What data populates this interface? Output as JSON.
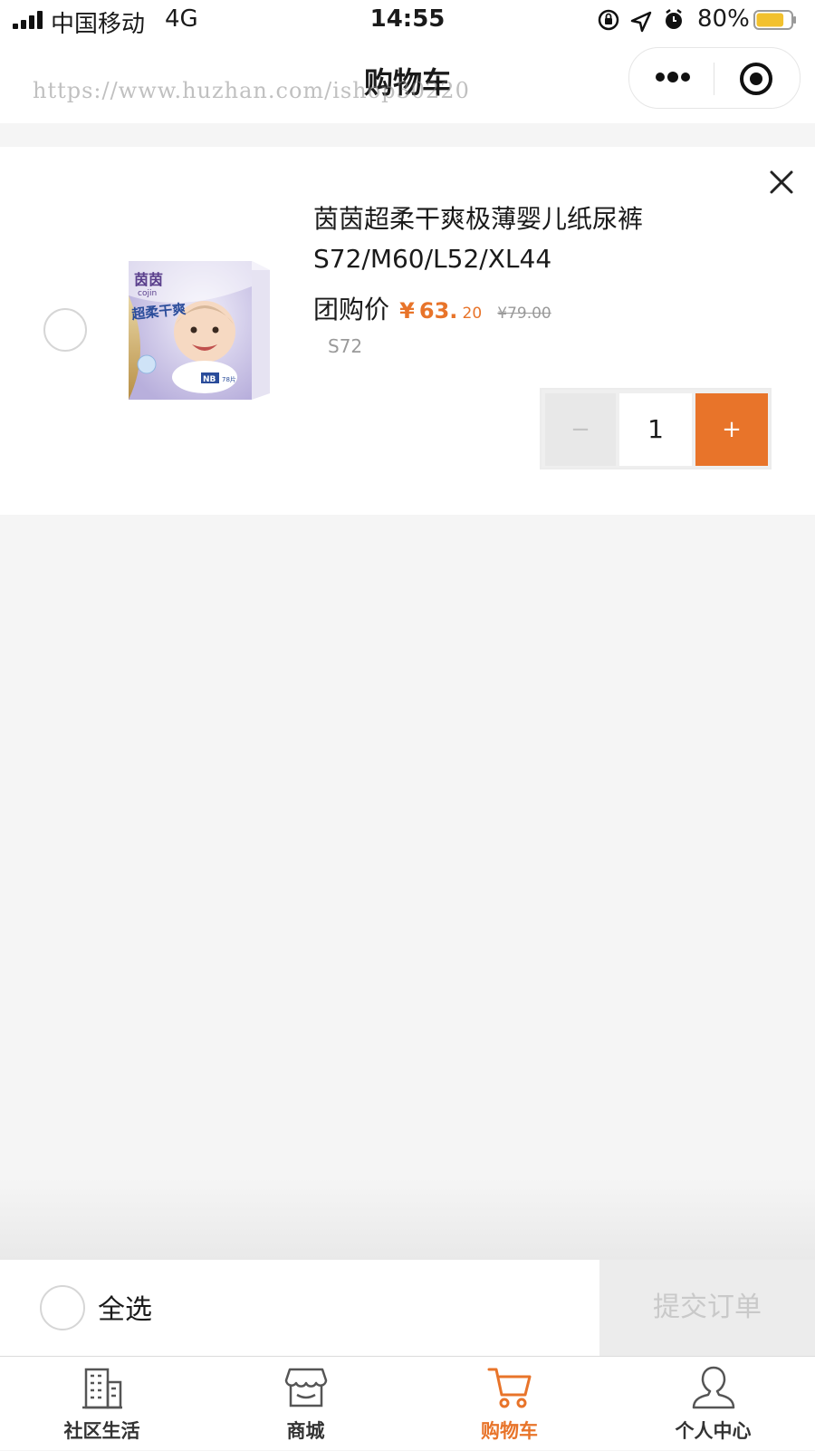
{
  "status_bar": {
    "carrier": "中国移动",
    "network": "4G",
    "time": "14:55",
    "battery": "80%",
    "battery_level": 0.8,
    "icons": [
      "orientation-lock-icon",
      "location-icon",
      "alarm-icon",
      "battery-icon",
      "signal-icon"
    ]
  },
  "nav": {
    "title": "购物车",
    "watermark": "https://www.huzhan.com/ishop30220"
  },
  "cart_item": {
    "title_line1": "茵茵超柔干爽极薄婴儿纸尿裤",
    "title_line2": "S72/M60/L52/XL44",
    "price_label": "团购价",
    "price_yen": "¥",
    "price_int": "63.",
    "price_dec": "20",
    "price_old": "¥79.00",
    "spec": "S72",
    "quantity": "1",
    "minus_label": "−",
    "plus_label": "+",
    "image_text": {
      "brand": "茵茵",
      "brand_en": "cojin",
      "product": "超柔干爽",
      "size": "NB",
      "count": "78片"
    }
  },
  "action_bar": {
    "select_all": "全选",
    "submit": "提交订单"
  },
  "tab_bar": {
    "tabs": [
      {
        "label": "社区生活",
        "icon": "building-icon",
        "active": false
      },
      {
        "label": "商城",
        "icon": "store-icon",
        "active": false
      },
      {
        "label": "购物车",
        "icon": "cart-icon",
        "active": true
      },
      {
        "label": "个人中心",
        "icon": "user-icon",
        "active": false
      }
    ]
  },
  "colors": {
    "accent": "#e8742a",
    "background": "#f5f5f5",
    "muted_text": "#9a9a9a"
  }
}
